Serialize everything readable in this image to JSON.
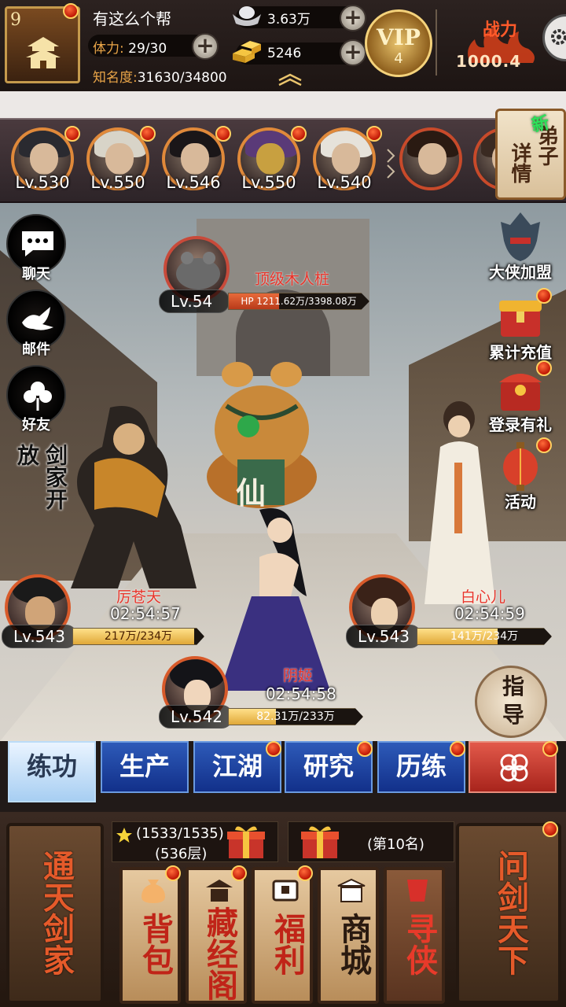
{
  "player": {
    "level": "9",
    "name": "有这么个帮",
    "stamina_label": "体力:",
    "stamina_value": "29/30",
    "fame_label": "知名度:",
    "fame_value": "31630/34800"
  },
  "currency": {
    "silver": "3.63万",
    "gold": "5246",
    "plus": "+"
  },
  "vip": {
    "label": "VIP",
    "level": "4"
  },
  "power": {
    "label": "战力",
    "value": "1000.4"
  },
  "disciples": [
    {
      "level": "Lv.530",
      "hair": "#2a2a30"
    },
    {
      "level": "Lv.550",
      "hair": "#d8d4c8"
    },
    {
      "level": "Lv.546",
      "hair": "#1a1618"
    },
    {
      "level": "Lv.550",
      "hair": "#5a3a78"
    },
    {
      "level": "Lv.540",
      "hair": "#e6e2da"
    },
    {
      "level": "",
      "hair": "#2a1a12"
    },
    {
      "level": "",
      "hair": "#3a2a22"
    }
  ],
  "disciple_details": {
    "label_a": "弟子",
    "label_b": "详情",
    "new_badge": "新"
  },
  "left_menu": [
    {
      "label": "聊天"
    },
    {
      "label": "邮件"
    },
    {
      "label": "好友"
    }
  ],
  "sword_badge": "剑家开放",
  "right_menu": [
    {
      "label": "大侠加盟"
    },
    {
      "label": "累计充值"
    },
    {
      "label": "登录有礼"
    },
    {
      "label": "活动"
    }
  ],
  "boss": {
    "name": "顶级木人桩",
    "level": "Lv.54",
    "hp": "HP 1211.62万/3398.08万",
    "hp_ratio": 0.357,
    "seal": "仙"
  },
  "units": [
    {
      "name": "厉苍天",
      "timer": "02:54:57",
      "level": "Lv.543",
      "hp": "217万/234万",
      "ratio": 0.93
    },
    {
      "name": "白心儿",
      "timer": "02:54:59",
      "level": "Lv.543",
      "hp": "141万/234万",
      "ratio": 0.6
    },
    {
      "name": "阴姬",
      "timer": "02:54:58",
      "level": "Lv.542",
      "hp": "82.31万/233万",
      "ratio": 0.35
    }
  ],
  "guide": "指导",
  "tabs": [
    {
      "label": "练功"
    },
    {
      "label": "生产"
    },
    {
      "label": "江湖"
    },
    {
      "label": "研究"
    },
    {
      "label": "历练"
    }
  ],
  "tower": {
    "stars": "(1533/1535)",
    "floor": "(536层)",
    "rank": "(第10名)"
  },
  "bottom": {
    "left_big": "通天剑家",
    "right_big": "问剑天下"
  },
  "bottom_menu": [
    {
      "label": "背包"
    },
    {
      "label": "藏经阁"
    },
    {
      "label": "福利"
    },
    {
      "label": "商城"
    },
    {
      "label": "寻侠"
    }
  ],
  "colors": {
    "accent_gold": "#e9a548",
    "tab_blue": "#2d5ab8",
    "notify_red": "#c01806"
  }
}
